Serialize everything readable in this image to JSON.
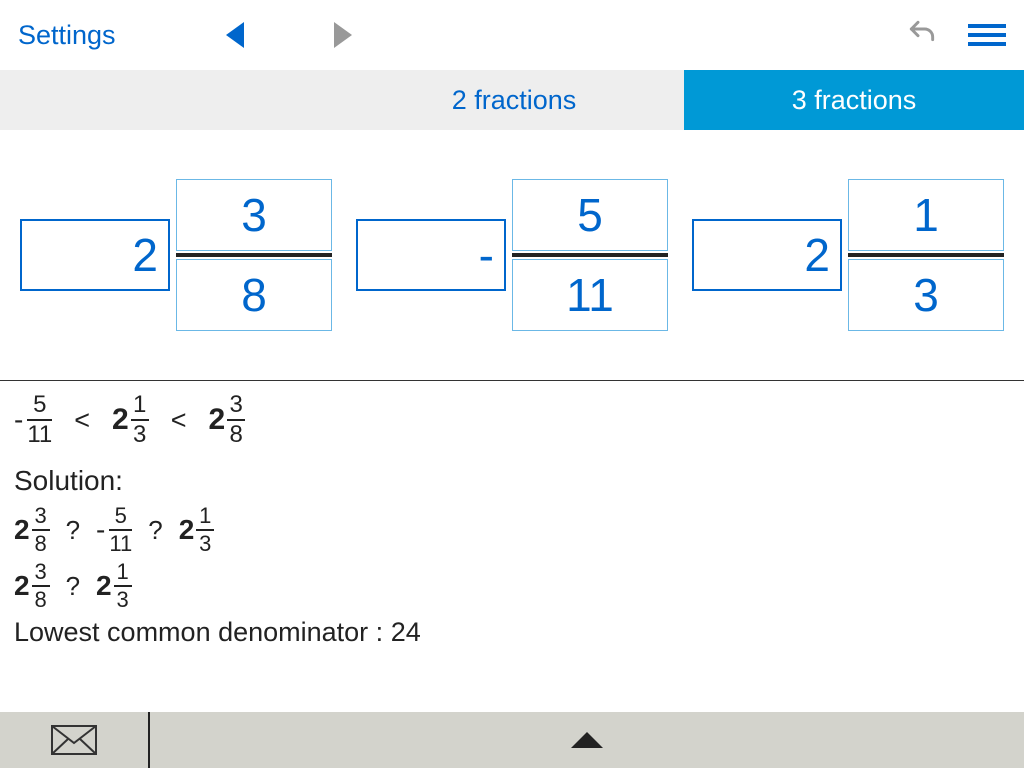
{
  "header": {
    "settings_label": "Settings"
  },
  "tabs": {
    "two_label": "2 fractions",
    "three_label": "3 fractions",
    "active": "three"
  },
  "inputs": [
    {
      "whole": "2",
      "num": "3",
      "den": "8"
    },
    {
      "whole": "-",
      "num": "5",
      "den": "11"
    },
    {
      "whole": "2",
      "num": "1",
      "den": "3"
    }
  ],
  "result_row": {
    "terms": [
      {
        "sign": "-",
        "whole": "",
        "num": "5",
        "den": "11"
      },
      {
        "sign": "",
        "whole": "2",
        "num": "1",
        "den": "3"
      },
      {
        "sign": "",
        "whole": "2",
        "num": "3",
        "den": "8"
      }
    ],
    "rel1": "<",
    "rel2": "<"
  },
  "solution": {
    "label": "Solution:",
    "row1": {
      "terms": [
        {
          "sign": "",
          "whole": "2",
          "num": "3",
          "den": "8"
        },
        {
          "sign": "-",
          "whole": "",
          "num": "5",
          "den": "11"
        },
        {
          "sign": "",
          "whole": "2",
          "num": "1",
          "den": "3"
        }
      ],
      "rel1": "?",
      "rel2": "?"
    },
    "row2": {
      "terms": [
        {
          "sign": "",
          "whole": "2",
          "num": "3",
          "den": "8"
        },
        {
          "sign": "",
          "whole": "2",
          "num": "1",
          "den": "3"
        }
      ],
      "rel1": "?"
    },
    "lcd_label": "Lowest common denominator : ",
    "lcd_value": "24"
  }
}
